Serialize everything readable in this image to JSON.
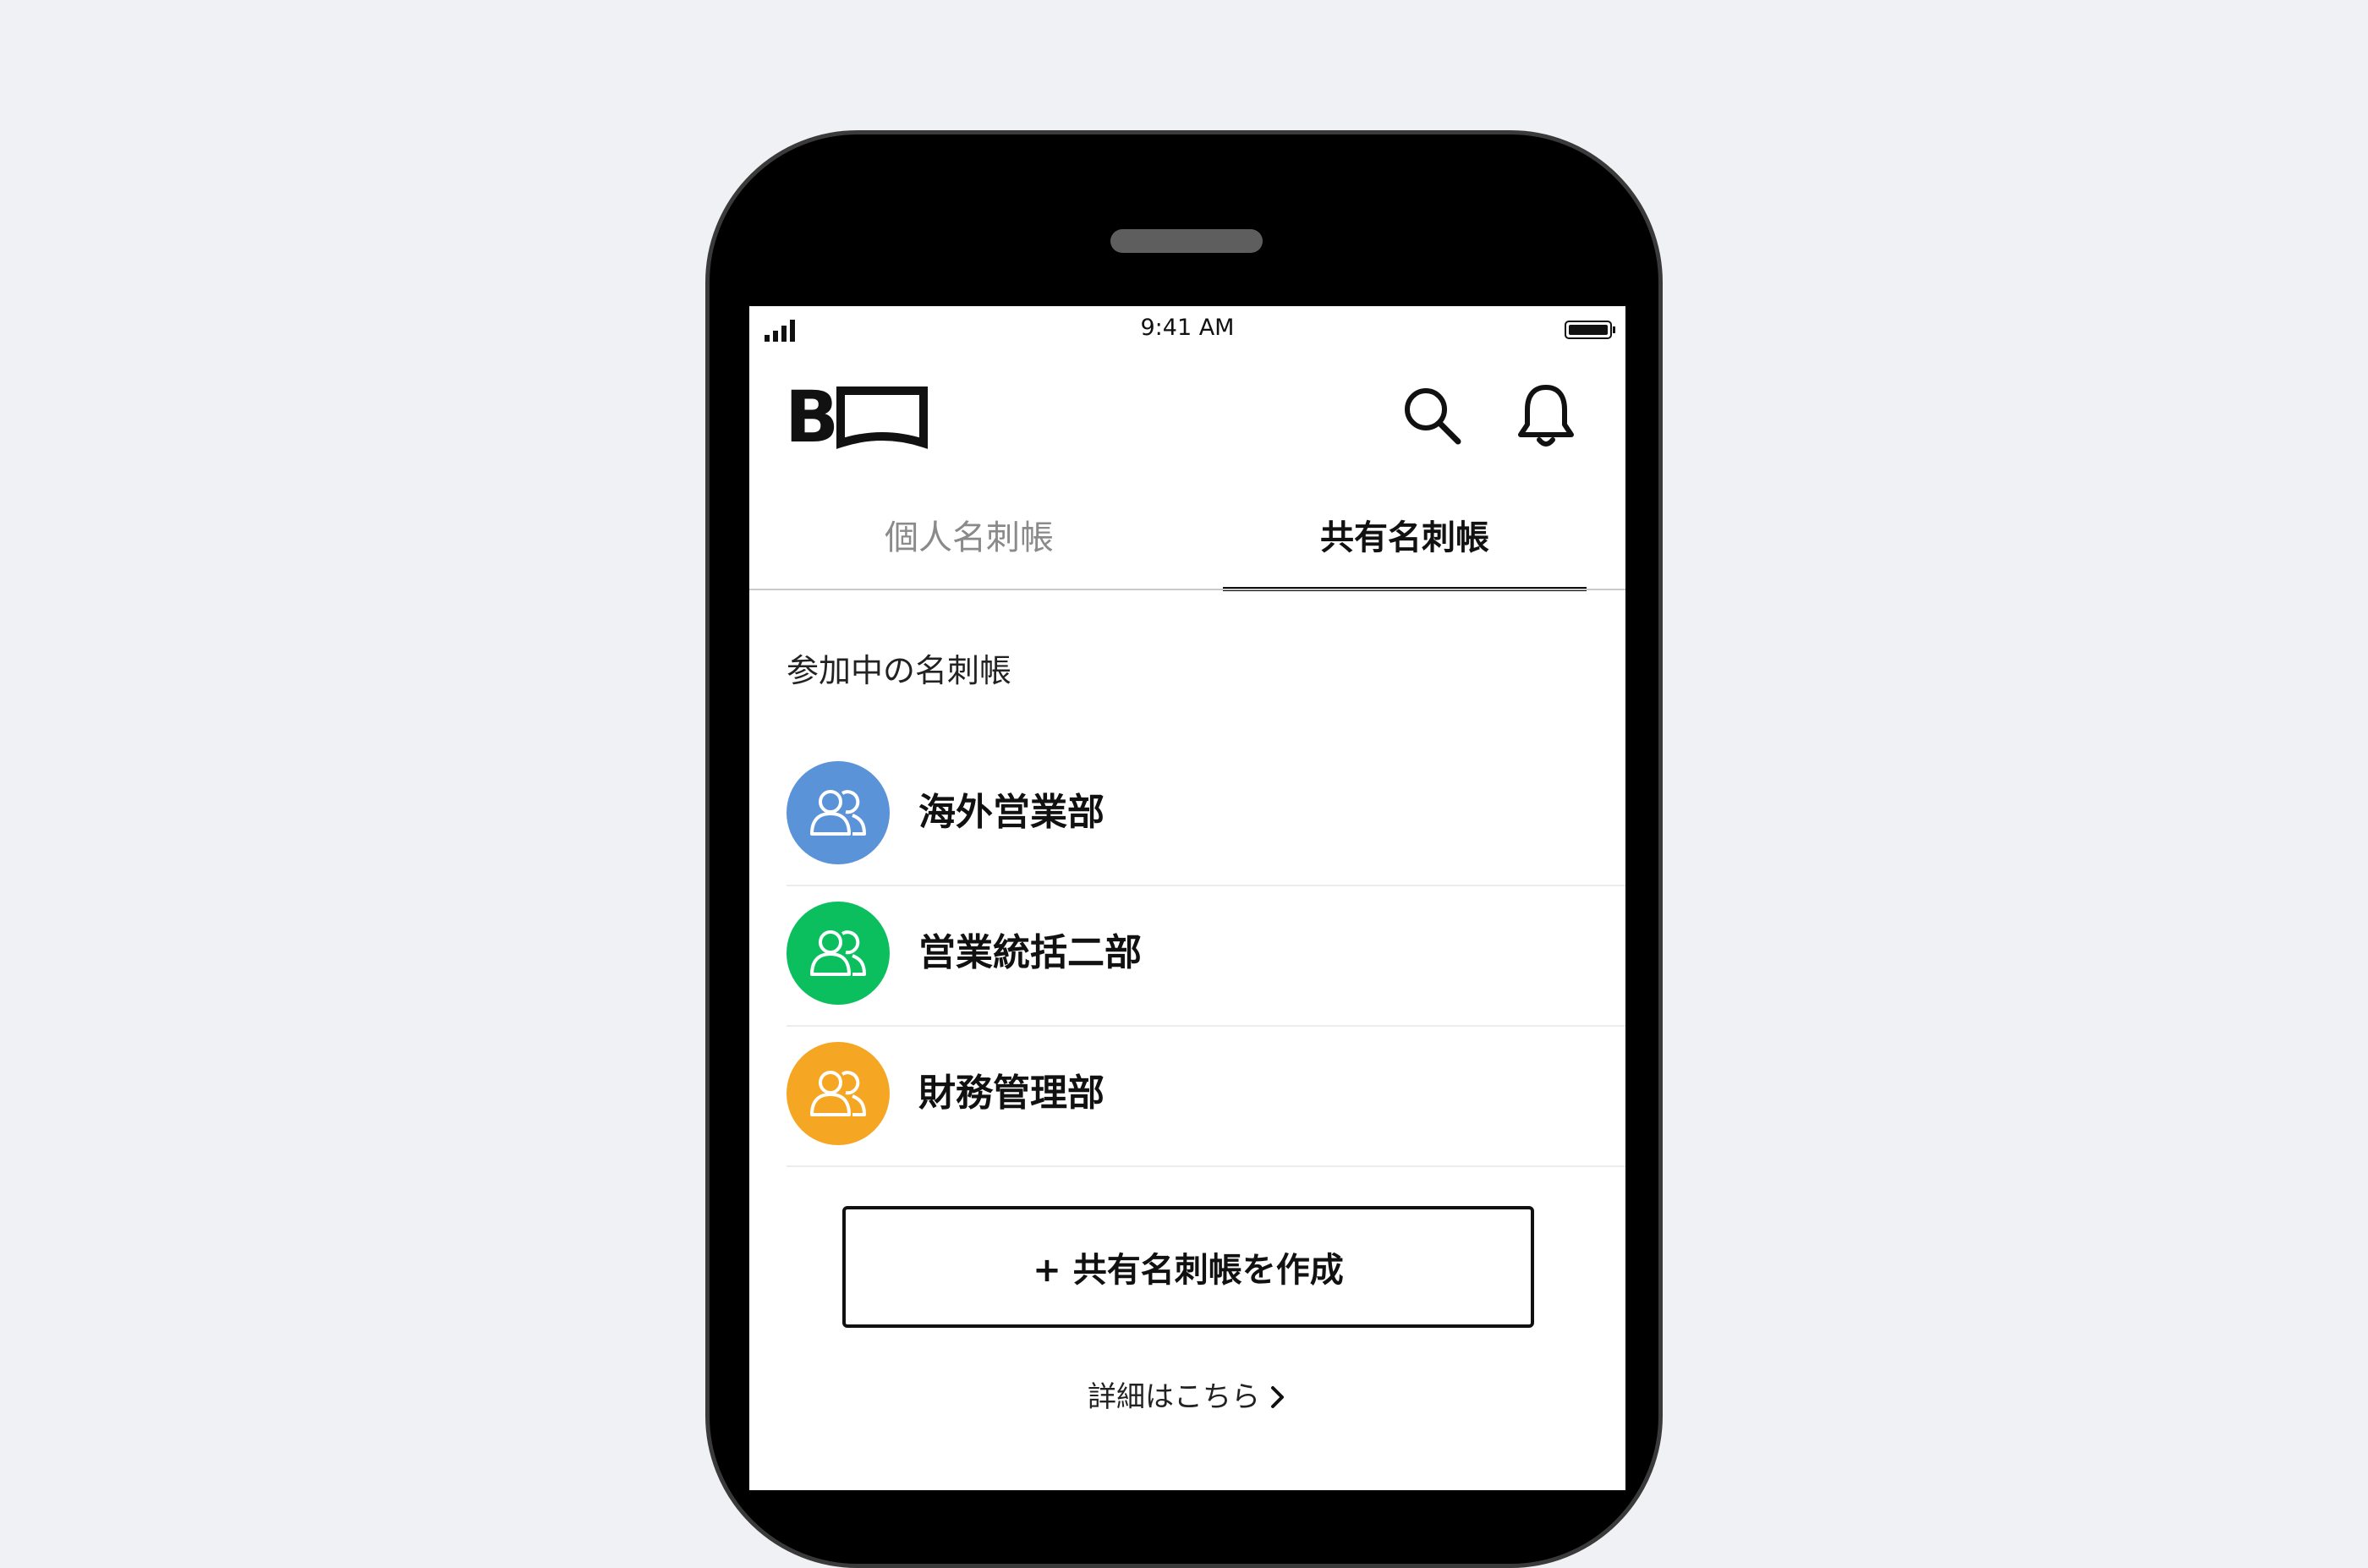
{
  "status_bar": {
    "time": "9:41 AM"
  },
  "header": {
    "logo_text": "B",
    "icons": [
      "search-icon",
      "bell-icon"
    ]
  },
  "tabs": [
    {
      "label": "個人名刺帳",
      "active": false
    },
    {
      "label": "共有名刺帳",
      "active": true
    }
  ],
  "section": {
    "title": "参加中の名刺帳"
  },
  "groups": [
    {
      "name": "海外営業部",
      "color": "#5b93d9",
      "icon": "group-icon"
    },
    {
      "name": "営業統括二部",
      "color": "#0bbf5f",
      "icon": "group-icon"
    },
    {
      "name": "財務管理部",
      "color": "#f5a623",
      "icon": "group-icon"
    }
  ],
  "create_button": {
    "label": "+ 共有名刺帳を作成"
  },
  "details_link": {
    "label": "詳細はこちら"
  },
  "colors": {
    "background": "#eff1f5",
    "phone_frame": "#000000",
    "accent_text": "#111111",
    "inactive_tab": "#8a8a8a"
  }
}
